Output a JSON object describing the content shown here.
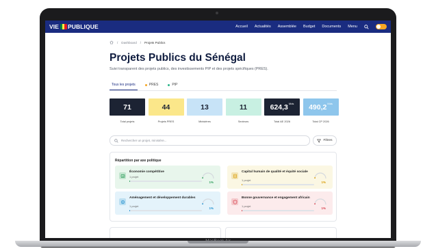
{
  "navbar": {
    "logo_left": "VIE",
    "logo_right": "PUBLIQUE",
    "flag_colors": [
      "#00853f",
      "#fdef42",
      "#e31b23"
    ],
    "links": [
      "Accueil",
      "Actualités",
      "Assemblée",
      "Budget",
      "Documents",
      "Menu"
    ],
    "search_icon": "search-icon",
    "theme_toggle_color": "#f5a623"
  },
  "breadcrumb": {
    "home_icon": "home-icon",
    "items": [
      "Dashboard",
      "Projets Publics"
    ]
  },
  "page": {
    "title": "Projets Publics du Sénégal",
    "subtitle": "Suivi transparent des projets publics, des investissements PIP et des projets spécifiques (PRES)."
  },
  "tabs": [
    {
      "label": "Tous les projets",
      "active": true
    },
    {
      "label": "PRES",
      "dot_color": "#f5a623"
    },
    {
      "label": "PIP",
      "dot_color": "#2bb58a"
    }
  ],
  "stats": [
    {
      "value": "71",
      "unit": "",
      "label": "Total projets",
      "bg": "#1c2333",
      "fg": "#ffffff"
    },
    {
      "value": "44",
      "unit": "",
      "label": "Projets PRES",
      "bg": "#fbe78a",
      "fg": "#1c2333"
    },
    {
      "value": "13",
      "unit": "",
      "label": "Ministères",
      "bg": "#c7e3f7",
      "fg": "#1c2333"
    },
    {
      "value": "11",
      "unit": "",
      "label": "Secteurs",
      "bg": "#c8f0e2",
      "fg": "#1c2333"
    },
    {
      "value": "624,3",
      "unit": "Mds",
      "label": "Total AE 2026",
      "bg": "#1c2333",
      "fg": "#ffffff"
    },
    {
      "value": "490,2",
      "unit": "Mds",
      "label": "Total CP 2026",
      "bg": "#8ec6ec",
      "fg": "#ffffff"
    }
  ],
  "search": {
    "placeholder": "Rechercher un projet, ministère...",
    "icon": "search-icon"
  },
  "filter": {
    "label": "Filtres",
    "icon": "filter-icon"
  },
  "axes": {
    "title": "Répartition par axe politique",
    "items": [
      {
        "name": "Économie compétitive",
        "count": "1 projet",
        "percent": "1%",
        "fraction": 0.01,
        "color": "#2e9e5b",
        "bg": "#e8f6ec",
        "icon": "trend-icon"
      },
      {
        "name": "Capital humain de qualité et équité sociale",
        "count": "1 projet",
        "percent": "1%",
        "fraction": 0.01,
        "color": "#d99a00",
        "bg": "#fbf7e3",
        "icon": "people-icon"
      },
      {
        "name": "Aménagement et développement durables",
        "count": "1 projet",
        "percent": "1%",
        "fraction": 0.01,
        "color": "#1f8fcf",
        "bg": "#e4f3fb",
        "icon": "leaf-icon"
      },
      {
        "name": "Bonne gouvernance et engagement africain",
        "count": "1 projet",
        "percent": "1%",
        "fraction": 0.01,
        "color": "#d9434f",
        "bg": "#fcebec",
        "icon": "shield-icon"
      }
    ]
  },
  "device": {
    "label": "MacBook Air"
  }
}
